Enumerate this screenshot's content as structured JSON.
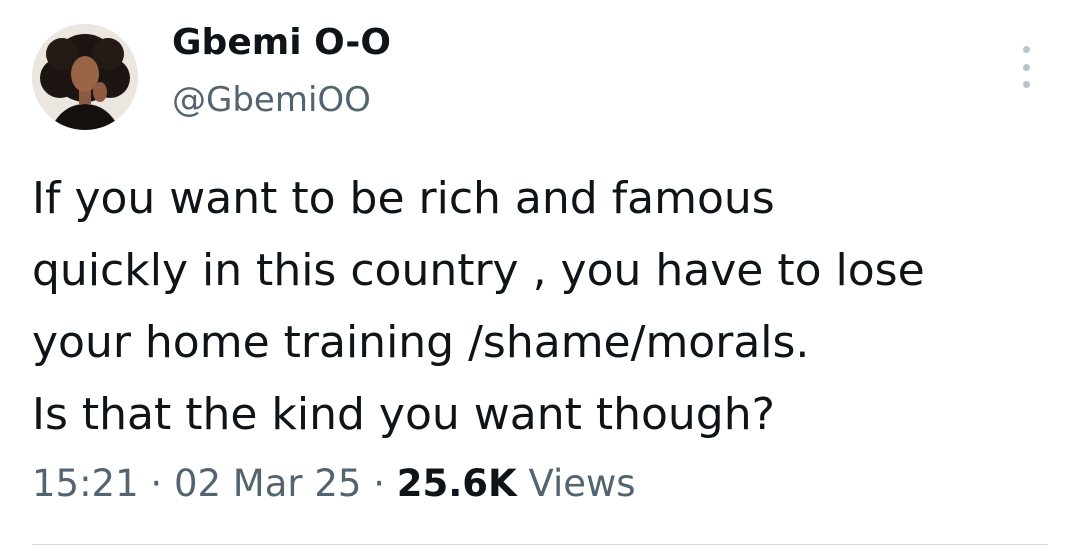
{
  "author": {
    "name": "Gbemi O-O",
    "handle": "@GbemiOO"
  },
  "menu": {
    "icon": "more-vertical-icon"
  },
  "tweet": {
    "lines": [
      "If you want to be rich and famous",
      "quickly in this country , you have to lose",
      "your home training /shame/morals.",
      "Is that the kind you want though?"
    ]
  },
  "meta": {
    "time": "15:21",
    "separator": "·",
    "date": "02 Mar 25",
    "views_count": "25.6K",
    "views_label": "Views"
  },
  "colors": {
    "text": "#0f1419",
    "secondary": "#536471",
    "divider": "#cfd9de"
  }
}
